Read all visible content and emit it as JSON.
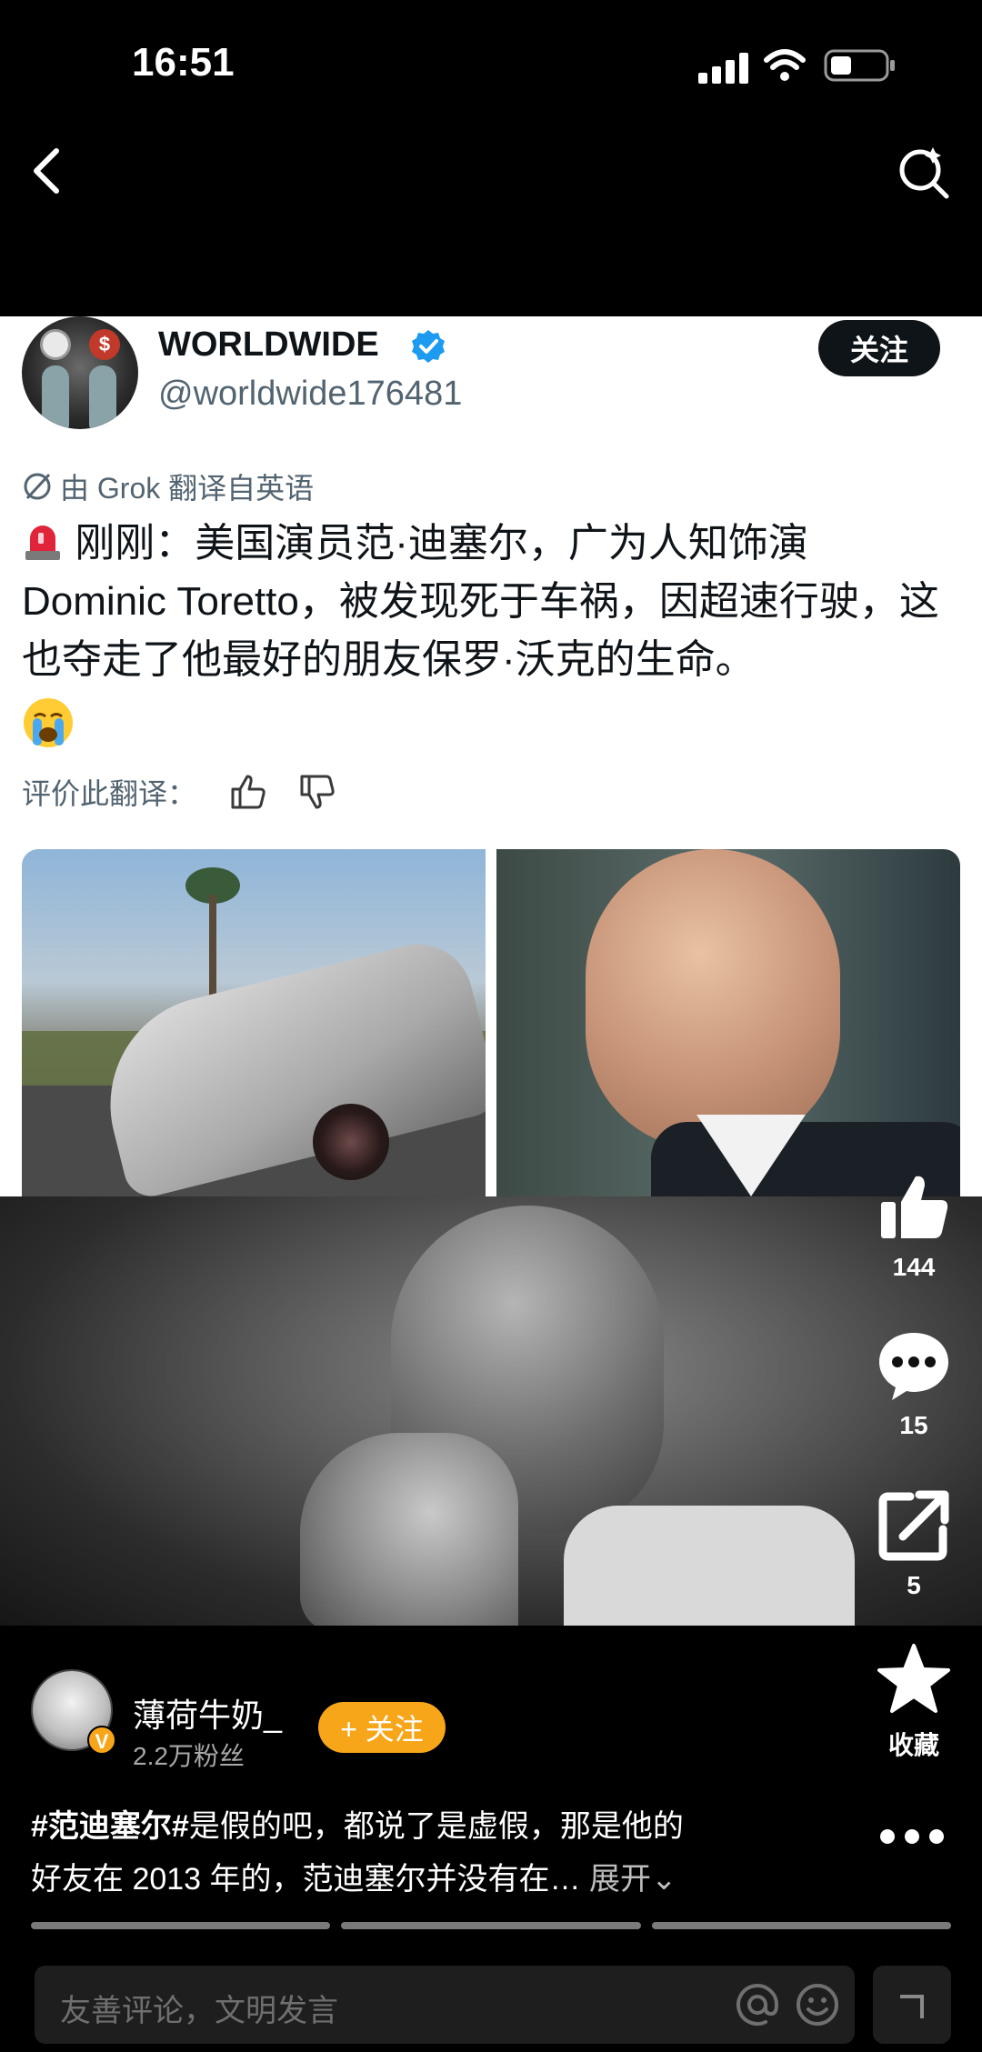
{
  "status_bar": {
    "time": "16:51"
  },
  "tweet": {
    "name": "WORLDWIDE",
    "handle": "@worldwide176481",
    "follow_label": "关注",
    "translated_from": "由 Grok 翻译自英语",
    "text": "刚刚：美国演员范·迪塞尔，广为人知饰演 Dominic Toretto，被发现死于车祸，因超速行驶，这也夺走了他最好的朋友保罗·沃克的生命。",
    "rate_label": "评价此翻译：",
    "icons": [
      "verified-icon",
      "translate-icon",
      "siren-icon",
      "crying-face-icon",
      "thumb-up-icon",
      "thumb-down-icon"
    ]
  },
  "actions": {
    "like_count": "144",
    "comment_count": "15",
    "share_count": "5",
    "collect_label": "收藏"
  },
  "author": {
    "name": "薄荷牛奶_",
    "fans": "2.2万粉丝",
    "follow_label": "+ 关注",
    "badge": "V"
  },
  "caption": {
    "tag": "#范迪塞尔#",
    "text_line1": "是假的吧，都说了是虚假，那是他的",
    "text_line2": "好友在 2013 年的，范迪塞尔并没有在…",
    "expand_label": "展开",
    "expand_symbol": "⌄"
  },
  "comment_bar": {
    "placeholder": "友善评论，文明发言"
  },
  "colors": {
    "accent_orange": "#f7a61a",
    "verified_blue": "#1d9bf0",
    "text_dark": "#0f1419",
    "text_gray": "#536471"
  }
}
